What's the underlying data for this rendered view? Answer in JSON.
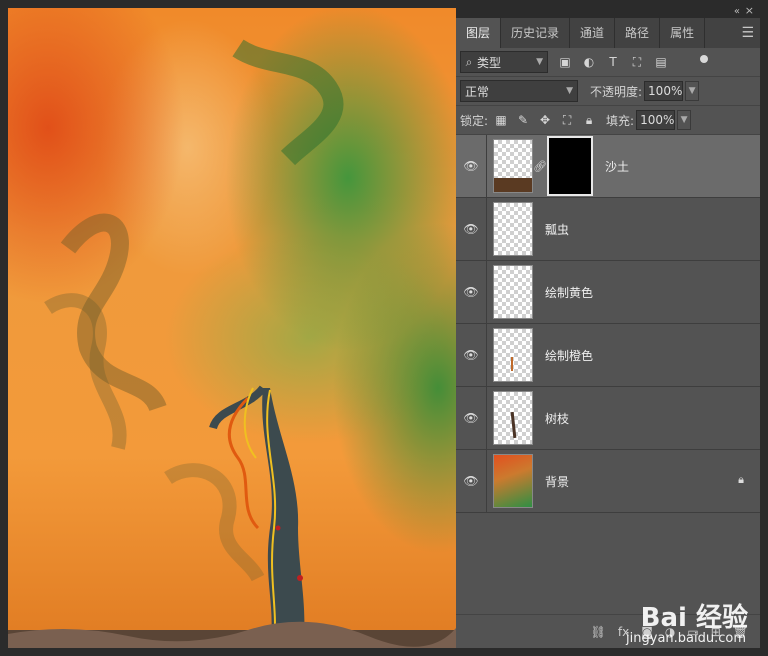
{
  "panel": {
    "tabs": [
      {
        "label": "图层"
      },
      {
        "label": "历史记录"
      },
      {
        "label": "通道"
      },
      {
        "label": "路径"
      },
      {
        "label": "属性"
      }
    ],
    "filter": {
      "selected": "类型"
    },
    "blend_mode": {
      "selected": "正常"
    },
    "opacity": {
      "label": "不透明度:",
      "value": "100%"
    },
    "lock": {
      "label": "锁定:"
    },
    "fill": {
      "label": "填充:",
      "value": "100%"
    },
    "layers": [
      {
        "name": "沙土"
      },
      {
        "name": "瓢虫"
      },
      {
        "name": "绘制黄色"
      },
      {
        "name": "绘制橙色"
      },
      {
        "name": "树枝"
      },
      {
        "name": "背景"
      }
    ],
    "bottom_bar": {
      "fx_label": "fx"
    }
  },
  "watermark": {
    "text": "Bai 经验",
    "url": "jingyan.baidu.com"
  }
}
